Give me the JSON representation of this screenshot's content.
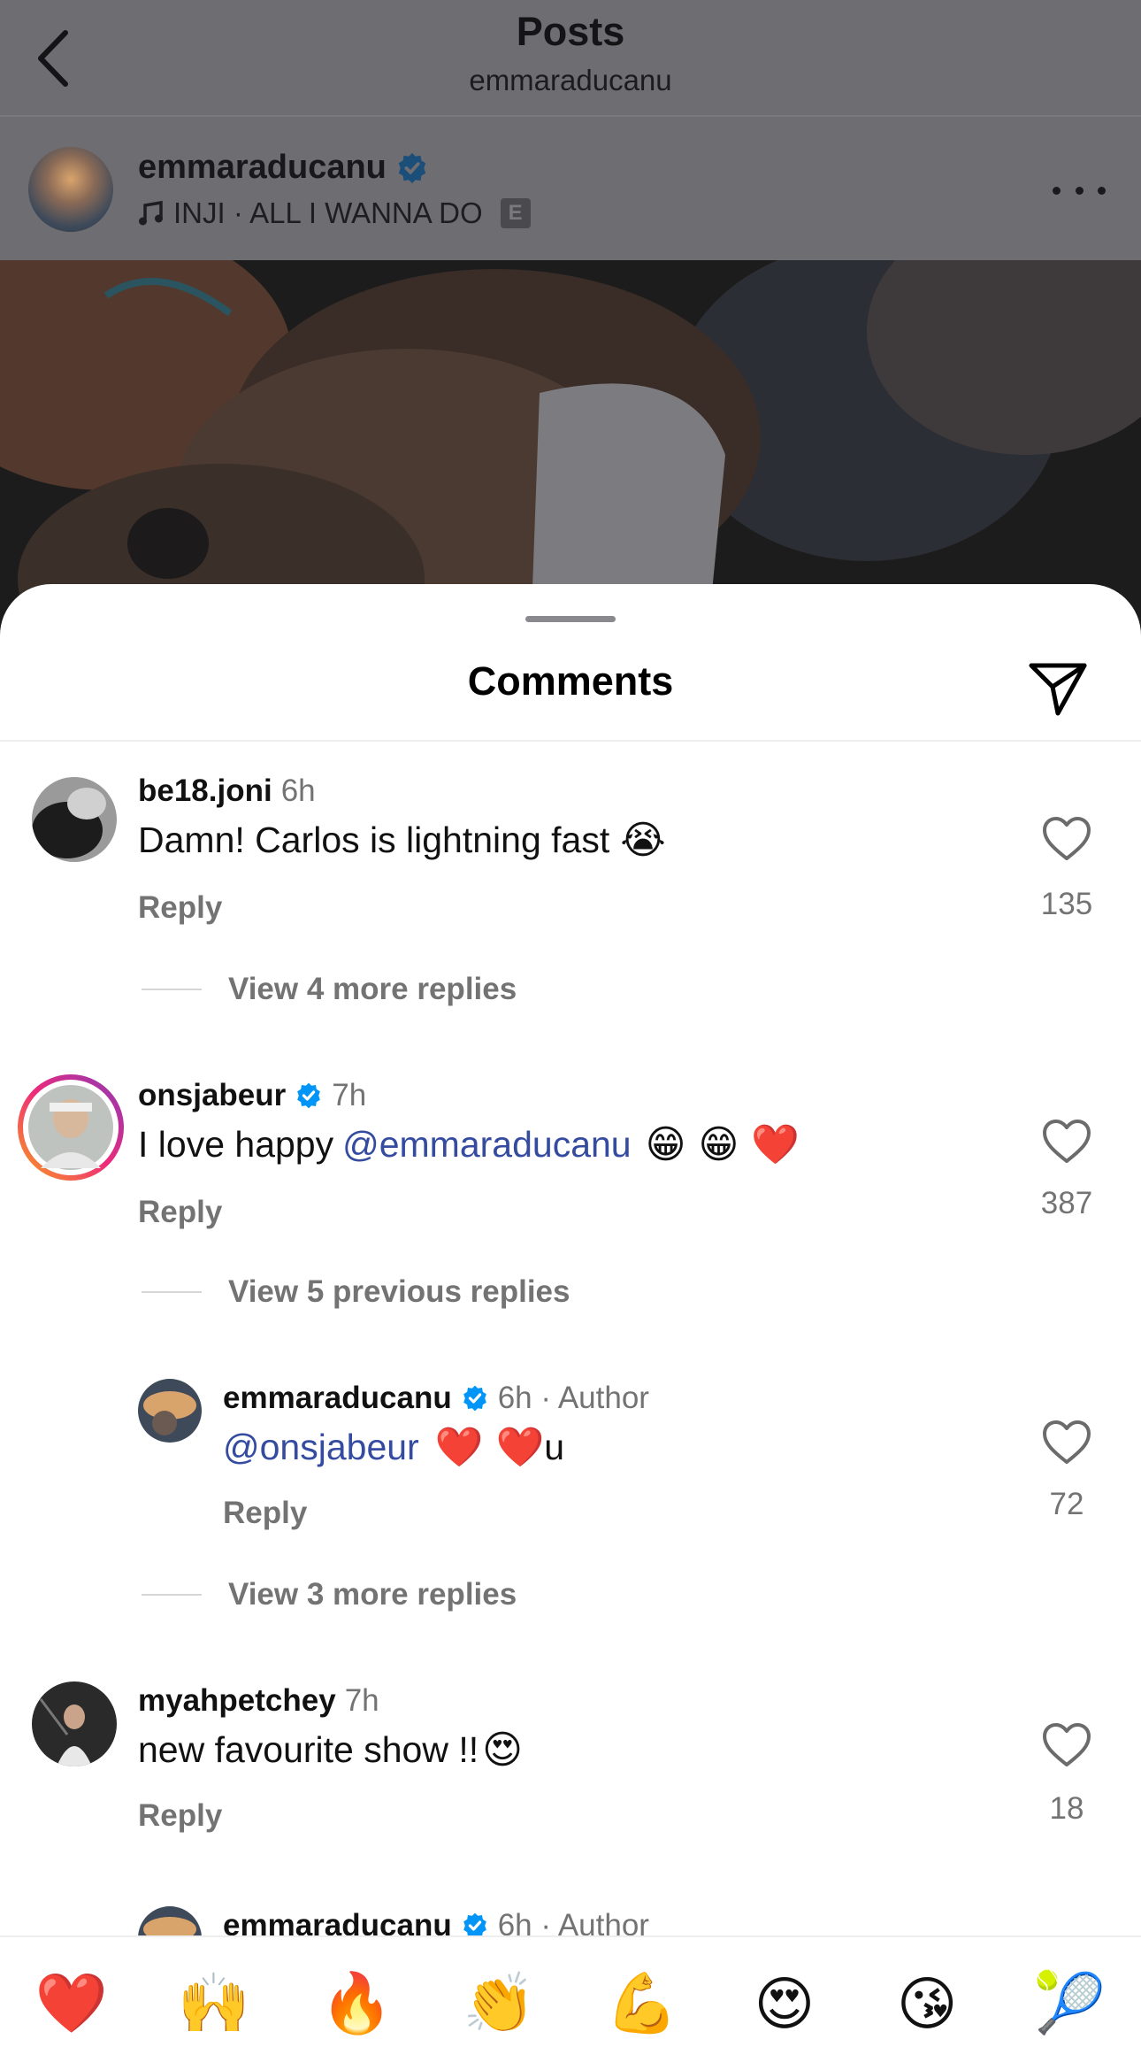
{
  "header": {
    "title": "Posts",
    "subtitle": "emmaraducanu"
  },
  "post": {
    "username": "emmaraducanu",
    "music": "INJI · ALL I WANNA DO",
    "explicit_badge": "E"
  },
  "sheet": {
    "title": "Comments"
  },
  "comments": [
    {
      "username": "be18.joni",
      "time": "6h",
      "text": "Damn! Carlos is lightning fast",
      "emoji": "😭",
      "reply_label": "Reply",
      "likes": "135",
      "view_replies": "View 4 more replies"
    },
    {
      "username": "onsjabeur",
      "time": "7h",
      "text": "I love happy ",
      "mention": "@emmaraducanu",
      "emoji": "😁 😁 ❤️",
      "reply_label": "Reply",
      "likes": "387",
      "view_replies": "View 5 previous replies"
    },
    {
      "username": "emmaraducanu",
      "time": "6h · Author",
      "mention": "@onsjabeur",
      "emoji": "❤️ ❤️",
      "text_after": "u",
      "reply_label": "Reply",
      "likes": "72",
      "view_replies": "View 3 more replies"
    },
    {
      "username": "myahpetchey",
      "time": "7h",
      "text": "new favourite show !!",
      "emoji": "😍",
      "reply_label": "Reply",
      "likes": "18"
    },
    {
      "username": "emmaraducanu",
      "time": "6h · Author"
    }
  ],
  "quick_emojis": [
    "❤️",
    "🙌",
    "🔥",
    "👏",
    "💪",
    "😍",
    "😘",
    "🎾"
  ],
  "colors": {
    "accent_verified": "#0095f6",
    "mention": "#344ba0",
    "secondary_text": "#737373"
  }
}
